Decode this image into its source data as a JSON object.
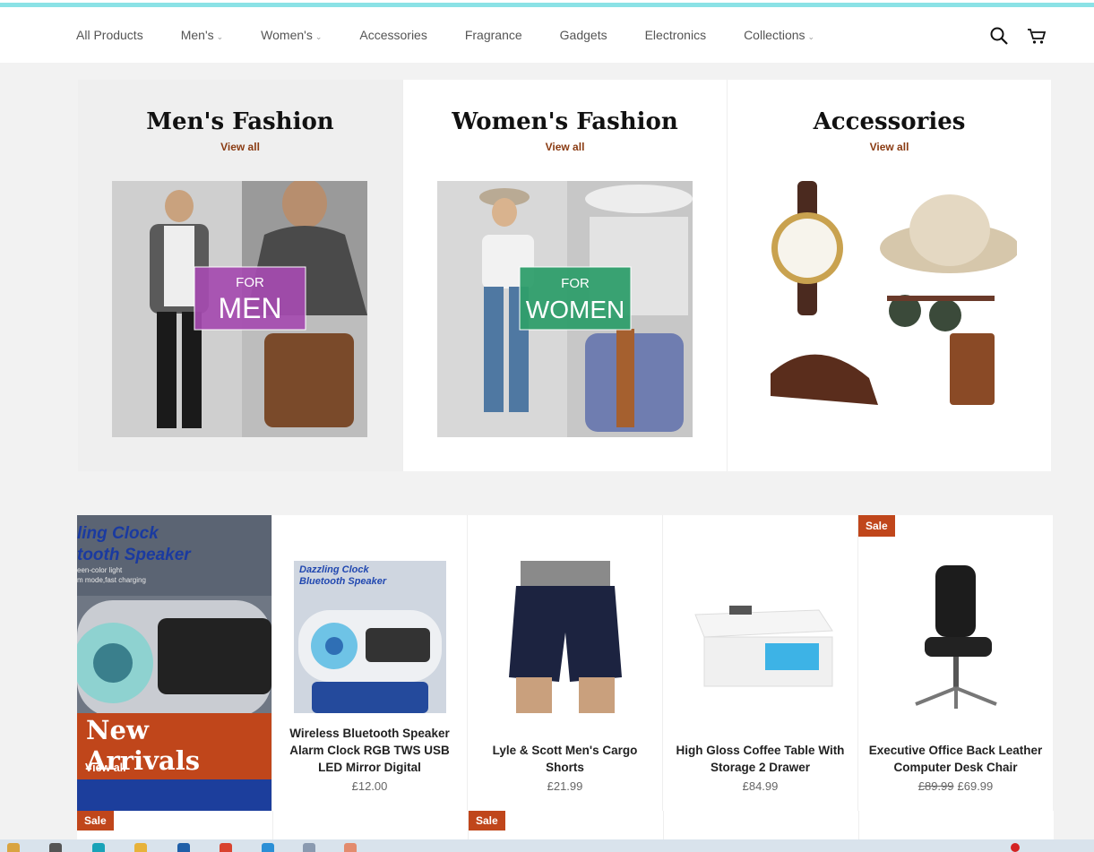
{
  "nav": {
    "items": [
      {
        "label": "All Products",
        "dropdown": false
      },
      {
        "label": "Men's",
        "dropdown": true
      },
      {
        "label": "Women's",
        "dropdown": true
      },
      {
        "label": "Accessories",
        "dropdown": false
      },
      {
        "label": "Fragrance",
        "dropdown": false
      },
      {
        "label": "Gadgets",
        "dropdown": false
      },
      {
        "label": "Electronics",
        "dropdown": false
      },
      {
        "label": "Collections",
        "dropdown": true
      }
    ],
    "search_icon": "search-icon",
    "cart_icon": "cart-icon"
  },
  "collections": [
    {
      "title": "Men's Fashion",
      "link": "View all",
      "badge_line1": "FOR",
      "badge_line2": "MEN",
      "badge_color": "#a54bb0"
    },
    {
      "title": "Women's Fashion",
      "link": "View all",
      "badge_line1": "FOR",
      "badge_line2": "WOMEN",
      "badge_color": "#2f9e6b"
    },
    {
      "title": "Accessories",
      "link": "View all"
    }
  ],
  "promo": {
    "headline_line1": "ling Clock",
    "headline_line2": "tooth Speaker",
    "sub_line1": "een-color light",
    "sub_line2": "m mode,fast charging",
    "banner": "New Arrivals",
    "link": "View all"
  },
  "products": [
    {
      "title": "Wireless Bluetooth Speaker Alarm Clock RGB TWS USB LED Mirror Digital",
      "price": "£12.00",
      "was": "",
      "sale": "",
      "img_text1": "Dazzling Clock",
      "img_text2": "Bluetooth Speaker"
    },
    {
      "title": "Lyle & Scott Men's Cargo Shorts",
      "price": "£21.99",
      "was": "",
      "sale": ""
    },
    {
      "title": "High Gloss Coffee Table With Storage 2 Drawer",
      "price": "£84.99",
      "was": "",
      "sale": ""
    },
    {
      "title": "Executive Office Back Leather Computer Desk Chair",
      "price": "£69.99",
      "was": "£89.99",
      "sale": "Sale"
    }
  ],
  "row2_badges": [
    "Sale",
    "Sale"
  ],
  "colors": {
    "accent": "#c0461b",
    "link": "#8a3b12",
    "teal_bar": "#8be2e6"
  }
}
